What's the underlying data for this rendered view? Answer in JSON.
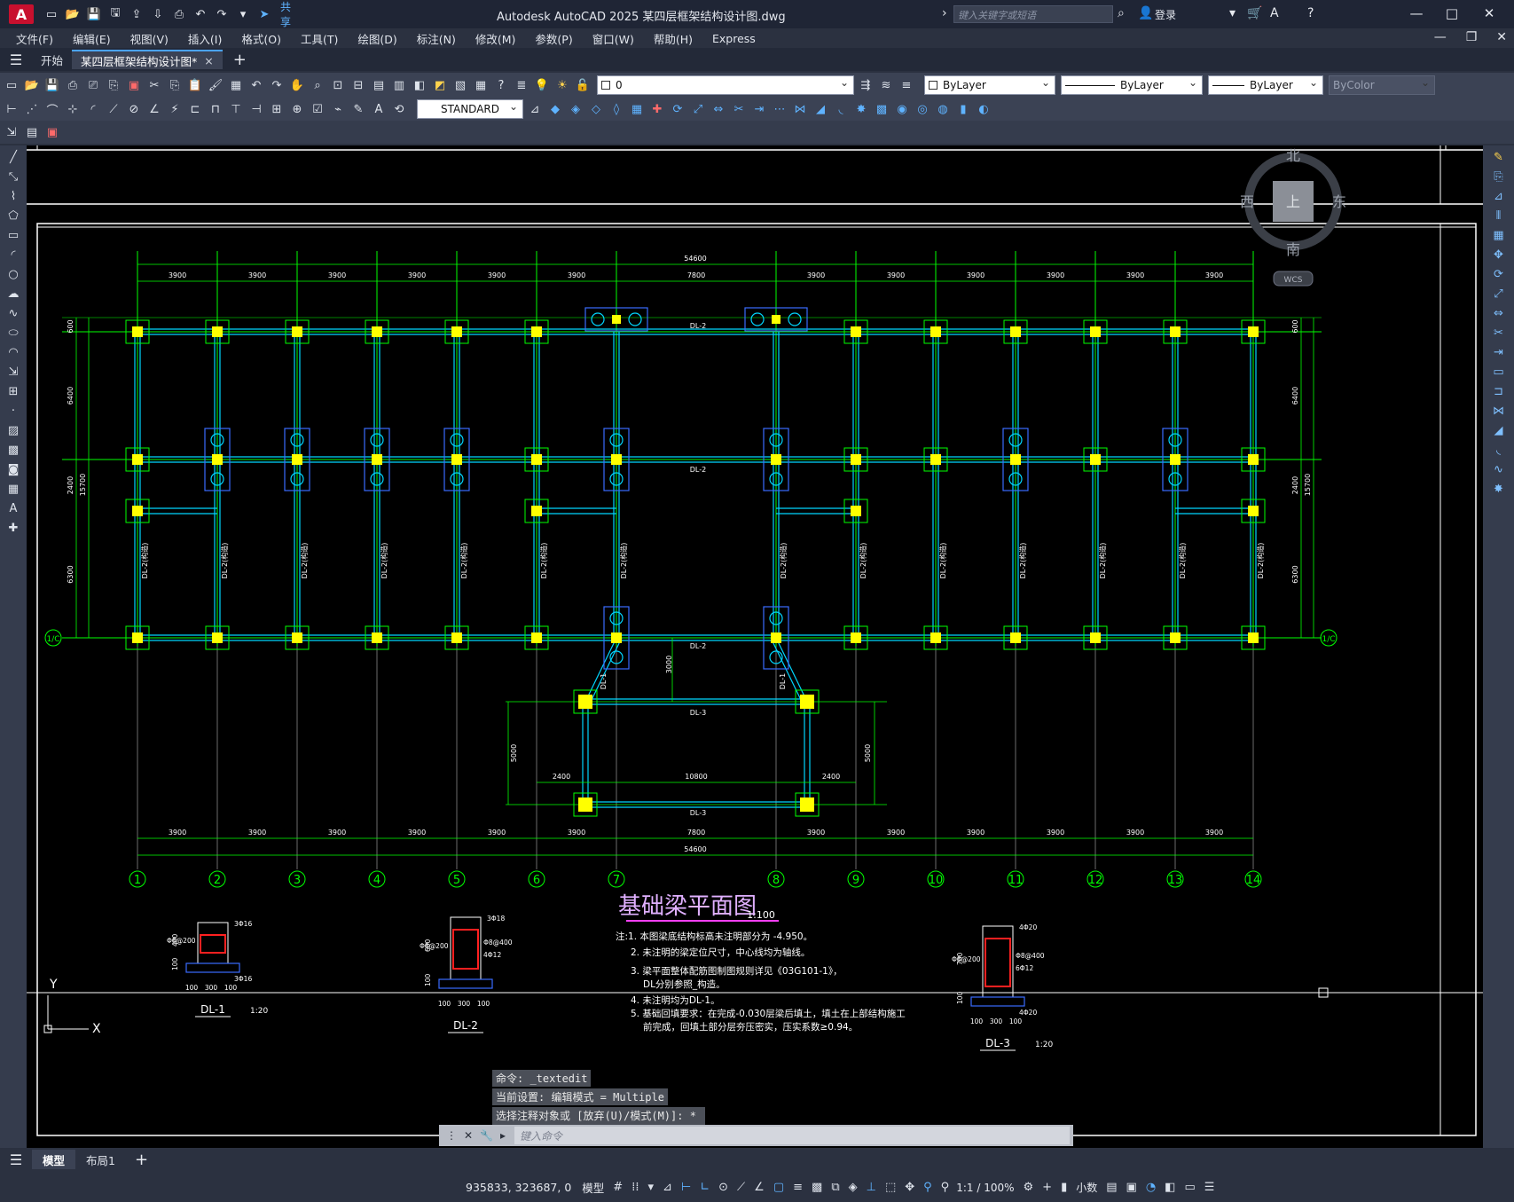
{
  "titlebar": {
    "logo": "A",
    "share_label": "共享",
    "title": "Autodesk AutoCAD 2025    某四层框架结构设计图.dwg",
    "search_placeholder": "键入关键字或短语",
    "login_label": "登录"
  },
  "menu": [
    "文件(F)",
    "编辑(E)",
    "视图(V)",
    "插入(I)",
    "格式(O)",
    "工具(T)",
    "绘图(D)",
    "标注(N)",
    "修改(M)",
    "参数(P)",
    "窗口(W)",
    "帮助(H)",
    "Express"
  ],
  "tabs": {
    "start": "开始",
    "doc": "某四层框架结构设计图*",
    "close": "×"
  },
  "ribbon": {
    "layer_value": "0",
    "color_value": "ByLayer",
    "linetype_value": "ByLayer",
    "lineweight_value": "ByLayer",
    "plotstyle_value": "ByColor",
    "textstyle_value": "STANDARD"
  },
  "viewcube": {
    "north": "北",
    "south": "南",
    "east": "东",
    "west": "西",
    "top": "上",
    "wcs": "WCS"
  },
  "drawing": {
    "axis_labels": [
      "1",
      "2",
      "3",
      "4",
      "5",
      "6",
      "7",
      "8",
      "9",
      "10",
      "11",
      "12",
      "13",
      "14"
    ],
    "row_label": "1/C",
    "top_total": "54600",
    "bay_dims": [
      "3900",
      "3900",
      "3900",
      "3900",
      "3900",
      "3900",
      "7800",
      "3900",
      "3900",
      "3900",
      "3900",
      "3900",
      "3900"
    ],
    "left_total": "15700",
    "left_dims": [
      "6400",
      "2400",
      "6300"
    ],
    "edge_dim": "600",
    "beam_labels": {
      "dl2": "DL-2",
      "dl3": "DL-3",
      "dl1": "DL-1",
      "dl2v": "DL-2(构造)"
    },
    "annex_dims": {
      "d3000": "3000",
      "d5000": "5000",
      "d2400": "2400",
      "d10800": "10800"
    },
    "title": "基础梁平面图",
    "title_scale": "1:100",
    "notes": [
      "注:1. 本图梁底结构标高未注明部分为 -4.950。",
      "2. 未注明的梁定位尺寸，中心线均为轴线。",
      "3. 梁平面整体配筋图制图规则详见《03G101-1》，",
      "DL分别参照_构造。",
      "4. 未注明均为DL-1。",
      "5. 基础回填要求：在完成-0.030层梁后填土，填土在上部结构施工",
      "前完成，回填土部分层夯压密实，压实系数≥0.94。"
    ],
    "sections": {
      "dl1": {
        "name": "DL-1",
        "scale": "1:20",
        "top": "3Φ16",
        "bot": "3Φ16",
        "stir": "Φ8@200",
        "h1": "400",
        "h2": "100",
        "w": [
          "100",
          "300",
          "100"
        ]
      },
      "dl2": {
        "name": "DL-2",
        "top": "3Φ18",
        "side": "Φ8@200",
        "side2": "Φ8@400",
        "bar": "4Φ12",
        "h": "600",
        "h2": "100",
        "w": [
          "100",
          "300",
          "100"
        ]
      },
      "dl3": {
        "name": "DL-3",
        "scale": "1:20",
        "top": "4Φ20",
        "side": "Φ8@200",
        "side2": "Φ8@400",
        "bar": "6Φ12",
        "bot": "4Φ20",
        "h": "700",
        "h2": "100",
        "w": [
          "100",
          "300",
          "100"
        ]
      }
    },
    "ucs": {
      "x": "X",
      "y": "Y"
    }
  },
  "command": {
    "history": [
      "命令:  _textedit",
      "当前设置: 编辑模式 = Multiple",
      "选择注释对象或 [放弃(U)/模式(M)]: *取消*"
    ],
    "placeholder": "键入命令"
  },
  "layouts": [
    "模型",
    "布局1"
  ],
  "status": {
    "coords": "935833, 323687, 0",
    "model": "模型",
    "scale": "1:1 / 100%",
    "units": "小数"
  }
}
